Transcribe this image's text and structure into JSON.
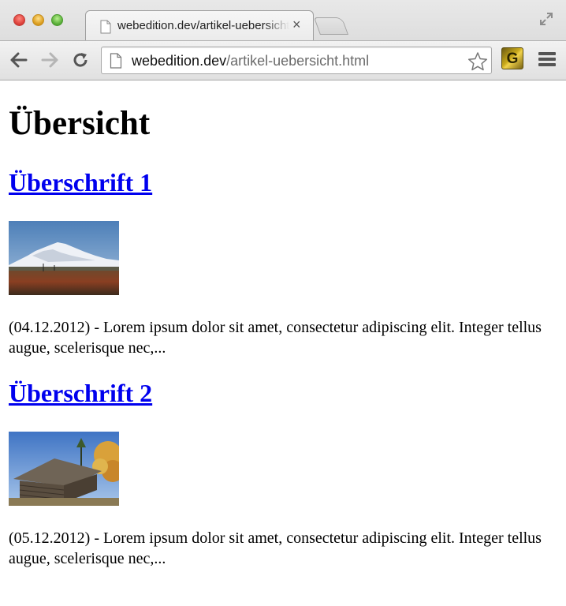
{
  "browser": {
    "tab_title": "webedition.dev/artikel-uebersicht.html",
    "tab_close": "×",
    "url_host": "webedition.dev",
    "url_path": "/artikel-uebersicht.html",
    "extension_label": "G",
    "icons": {
      "back": "back-arrow-icon",
      "forward": "forward-arrow-icon",
      "reload": "reload-icon",
      "page": "page-icon",
      "star": "star-icon",
      "menu": "menu-icon",
      "fullscreen": "fullscreen-icon"
    }
  },
  "page": {
    "title": "Übersicht",
    "articles": [
      {
        "headline": "Überschrift 1",
        "date": "(04.12.2012)",
        "separator": " - ",
        "teaser": "Lorem ipsum dolor sit amet, consectetur adipiscing elit. Integer tellus augue, scelerisque nec,...",
        "image": "mountain-landscape-image"
      },
      {
        "headline": "Überschrift 2",
        "date": "(05.12.2012)",
        "separator": " - ",
        "teaser": "Lorem ipsum dolor sit amet, consectetur adipiscing elit. Integer tellus augue, scelerisque nec,...",
        "image": "log-cabin-image"
      }
    ],
    "colors": {
      "link": "#0000ee",
      "text": "#000000"
    }
  }
}
